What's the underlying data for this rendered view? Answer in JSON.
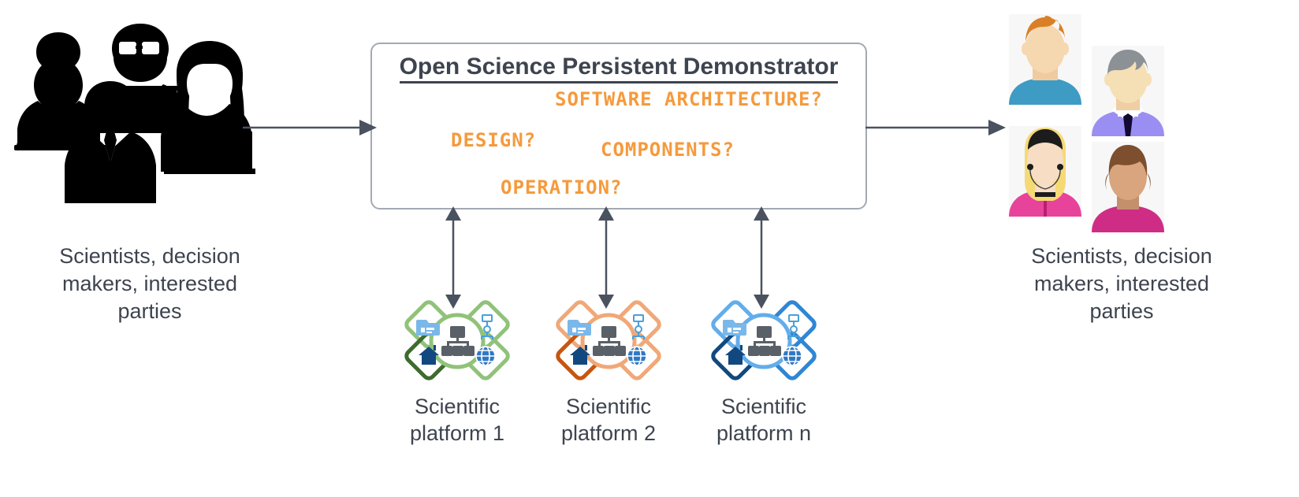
{
  "diagram": {
    "title": "Open Science Persistent Demonstrator diagram",
    "colors": {
      "orange_text": "#F59A3C",
      "text_dark": "#3d444f",
      "box_border": "#a3a9b3",
      "arrow": "#4a5260",
      "platform_1": "#90c27a",
      "platform_1_dark": "#3e6b2e",
      "platform_2": "#f0a878",
      "platform_2_dark": "#c75510",
      "platform_n": "#63adea",
      "platform_n_dark": "#11487f"
    }
  },
  "left_group": {
    "caption": "Scientists, decision\nmakers, interested\nparties",
    "people_count": 4
  },
  "right_group": {
    "caption": "Scientists, decision\nmakers, interested\nparties",
    "avatars": [
      {
        "name": "avatar-orange-hair-man",
        "hair": "#d98026",
        "shirt": "#3d9bc4",
        "skin": "#f5d7b0"
      },
      {
        "name": "avatar-gray-hair-man",
        "hair": "#8c9196",
        "shirt": "#9b8ef2",
        "skin": "#f5dfb4"
      },
      {
        "name": "avatar-blonde-woman",
        "hair": "#f5d975",
        "shirt": "#e8439b",
        "skin": "#f7ddc3"
      },
      {
        "name": "avatar-brown-hair-woman",
        "hair": "#7d4f2e",
        "shirt": "#cf2d85",
        "skin": "#d9a57e"
      }
    ]
  },
  "center_box": {
    "title": "Open Science Persistent Demonstrator",
    "questions": [
      {
        "id": "architecture",
        "label": "SOFTWARE ARCHITECTURE?"
      },
      {
        "id": "design",
        "label": "DESIGN?"
      },
      {
        "id": "components",
        "label": "COMPONENTS?"
      },
      {
        "id": "operation",
        "label": "OPERATION?"
      }
    ]
  },
  "platforms": [
    {
      "id": "platform-1",
      "label": "Scientific\nplatform 1",
      "light": "#90c27a",
      "dark": "#3e6b2e"
    },
    {
      "id": "platform-2",
      "label": "Scientific\nplatform 2",
      "light": "#f0a878",
      "dark": "#c75510"
    },
    {
      "id": "platform-n",
      "label": "Scientific\nplatform n",
      "light": "#63adea",
      "dark": "#11487f"
    }
  ],
  "arrows": [
    {
      "id": "arrow-in",
      "direction": "right",
      "from": "left_group",
      "to": "center_box"
    },
    {
      "id": "arrow-out",
      "direction": "right",
      "from": "center_box",
      "to": "right_group"
    },
    {
      "id": "arrow-p1",
      "direction": "both",
      "from": "center_box",
      "to": "platform-1"
    },
    {
      "id": "arrow-p2",
      "direction": "both",
      "from": "center_box",
      "to": "platform-2"
    },
    {
      "id": "arrow-pn",
      "direction": "both",
      "from": "center_box",
      "to": "platform-n"
    }
  ]
}
